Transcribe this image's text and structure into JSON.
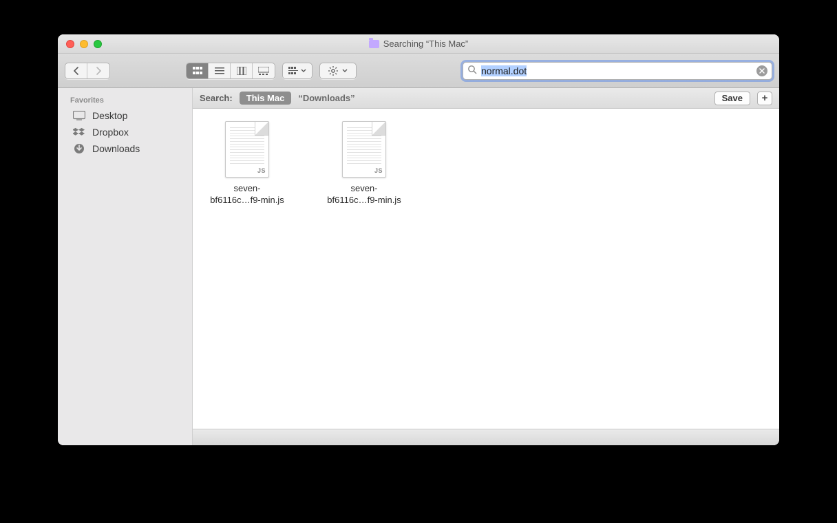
{
  "window": {
    "title": "Searching “This Mac”"
  },
  "search": {
    "query": "normal.dot"
  },
  "scope": {
    "label": "Search:",
    "active": "This Mac",
    "other": "“Downloads”",
    "save_label": "Save",
    "plus_label": "+"
  },
  "sidebar": {
    "header": "Favorites",
    "items": [
      {
        "label": "Desktop"
      },
      {
        "label": "Dropbox"
      },
      {
        "label": "Downloads"
      }
    ]
  },
  "files": [
    {
      "badge": "JS",
      "name_line1": "seven-",
      "name_line2": "bf6116c…f9-min.js"
    },
    {
      "badge": "JS",
      "name_line1": "seven-",
      "name_line2": "bf6116c…f9-min.js"
    }
  ]
}
